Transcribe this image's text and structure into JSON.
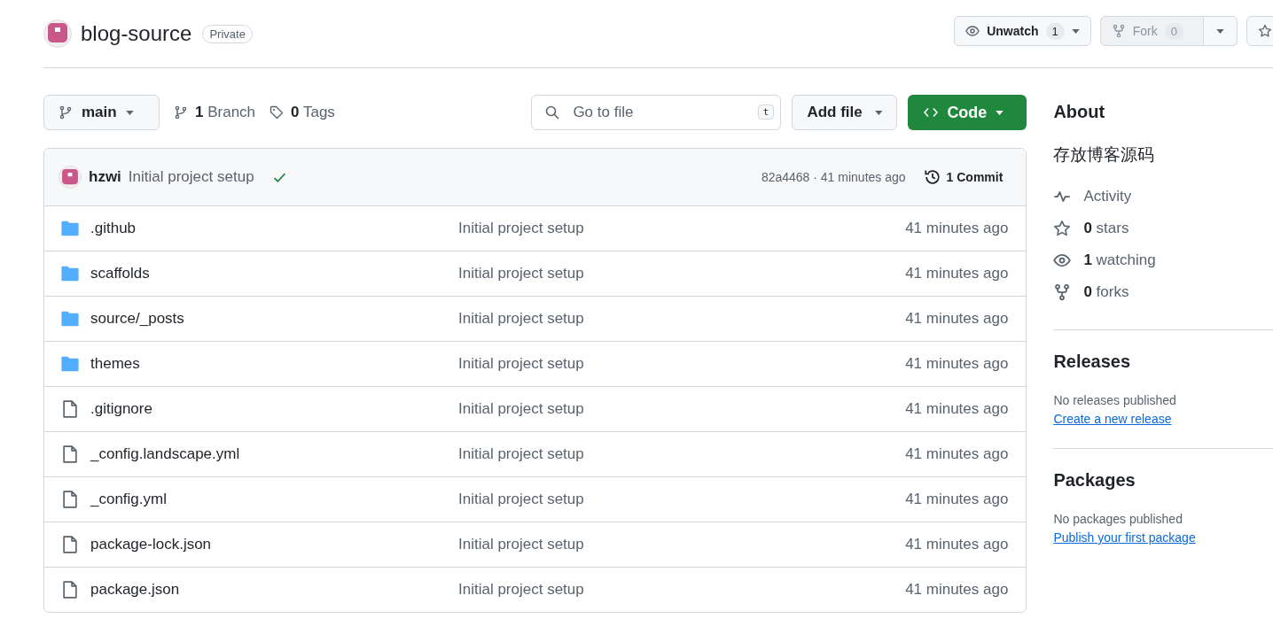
{
  "repo": {
    "name": "blog-source",
    "visibility": "Private"
  },
  "actions": {
    "watch": {
      "label": "Unwatch",
      "count": "1"
    },
    "fork": {
      "label": "Fork",
      "count": "0"
    }
  },
  "toolbar": {
    "branch": "main",
    "branches_count": "1",
    "branches_label": "Branch",
    "tags_count": "0",
    "tags_label": "Tags",
    "search": {
      "placeholder": "Go to file",
      "shortcut": "t"
    },
    "add_file": "Add file",
    "code": "Code"
  },
  "latest_commit": {
    "author": "hzwi",
    "message": "Initial project setup",
    "checks_passed": true,
    "hash_time": "82a4468 · 41 minutes ago",
    "commits": "1 Commit"
  },
  "files": [
    {
      "kind": "folder",
      "name": ".github",
      "message": "Initial project setup",
      "time": "41 minutes ago"
    },
    {
      "kind": "folder",
      "name": "scaffolds",
      "message": "Initial project setup",
      "time": "41 minutes ago"
    },
    {
      "kind": "folder",
      "name": "source/_posts",
      "message": "Initial project setup",
      "time": "41 minutes ago"
    },
    {
      "kind": "folder",
      "name": "themes",
      "message": "Initial project setup",
      "time": "41 minutes ago"
    },
    {
      "kind": "file",
      "name": ".gitignore",
      "message": "Initial project setup",
      "time": "41 minutes ago"
    },
    {
      "kind": "file",
      "name": "_config.landscape.yml",
      "message": "Initial project setup",
      "time": "41 minutes ago"
    },
    {
      "kind": "file",
      "name": "_config.yml",
      "message": "Initial project setup",
      "time": "41 minutes ago"
    },
    {
      "kind": "file",
      "name": "package-lock.json",
      "message": "Initial project setup",
      "time": "41 minutes ago"
    },
    {
      "kind": "file",
      "name": "package.json",
      "message": "Initial project setup",
      "time": "41 minutes ago"
    }
  ],
  "about": {
    "title": "About",
    "description": "存放博客源码",
    "stats": [
      {
        "kind": "activity",
        "text": "Activity"
      },
      {
        "kind": "star",
        "text": "**0** stars"
      },
      {
        "kind": "eye",
        "text": "**1** watching"
      },
      {
        "kind": "fork",
        "text": "**0** forks"
      }
    ]
  },
  "releases": {
    "title": "Releases",
    "note": "No releases published",
    "link": "Create a new release"
  },
  "packages": {
    "title": "Packages",
    "note": "No packages published",
    "link": "Publish your first package"
  }
}
